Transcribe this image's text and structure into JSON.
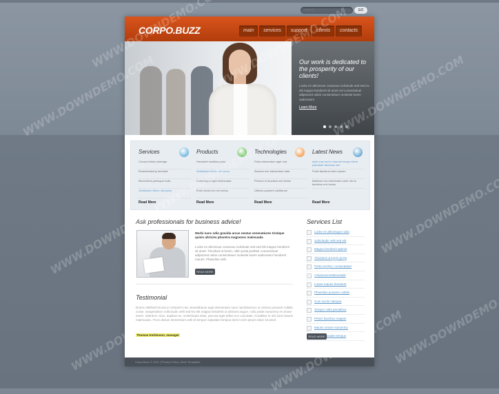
{
  "search": {
    "placeholder": "search",
    "button": "GO"
  },
  "header": {
    "logo": "CORPO.BUZZ",
    "nav": [
      "main",
      "services",
      "support",
      "clients",
      "contacts"
    ]
  },
  "hero": {
    "title": "Our work is dedicated to the prosperity of our clients!",
    "text": "Locke et ultriceisue cossusue solicitude sett sed ex elit magna hendrerit sit amet vel consectetuer adipiscent odios consectetuer molestie lorem sadecetum.",
    "link": "Learn More",
    "slides_total": 5,
    "slide_active": 1
  },
  "features": [
    {
      "title": "Services",
      "icon": "globe-icon",
      "icon_color": "#3a9bd5",
      "items": [
        "Consect feluis delenige",
        "Elmentemtumy hendrett",
        "Mecenefus penisque nulla",
        "Vestibulum libero nisl porta"
      ],
      "more": "Read More"
    },
    {
      "title": "Products",
      "icon": "plus-icon",
      "icon_color": "#3fae2a",
      "items": [
        "Hendrerit vestibus pons",
        "Vestibulum libero nisl porta",
        "Scelerisque eget malesuada",
        "Enim donec leo vel metus"
      ],
      "more": "Read More"
    },
    {
      "title": "Technologies",
      "icon": "star-icon",
      "icon_color": "#ef7d17",
      "items": [
        "Porta elementum eget mut",
        "Aenean non elementum ante",
        "Phoneo in faucibus sed lectus",
        "Ultrices posuere cubilianue"
      ],
      "more": "Read More"
    },
    {
      "title": "Latest News",
      "icon": "download-icon",
      "icon_color": "#2f86c4",
      "items": [
        "April cras orci in edomet neque intem palestate alimeras mei",
        "Porta faucibus lorem ipsum",
        "Mallnam nec elementum ante nisi in faucibus orci luctus"
      ],
      "more": "Read More"
    }
  ],
  "advice": {
    "title": "Ask professionals for business advice!",
    "lead": "Morbi nunc odio gravida arcus neutus venenatiures tristique quisis ultricies pharetra magnenec malesuada",
    "text": "Locke et ultriceisue cossusue solicitude sett sed elit magna hendrerit sit amet. Tincidunt ut lorem, nibin porta porttitor consectetuer adipiscent odios consectetuer molestie lorem sadecetum hendrerit mauris. Phasellus velit.",
    "button": "READ MORE"
  },
  "testimonial": {
    "title": "Testimonial",
    "text": "Donec eleifend sit arcus tortiraelet nec venentibaum eget elementum nunc nacloducibus ut ultrices posuere cubilia curae. Suspendisse sollicitudin velit sed leo elit magna hendrerit ut ultricies augue, nulla pede nonummy et ornare lorem. Interdum vitae, dapibus ac, scelerisque vitae, pecosa eget tellus non vulputate. Curabitur in nisi sunt mauris malesuada. Proin dictum elementum velit et tempor vulputate tempus dorsi lorem ipsum dolor sit amet.",
    "author": "Thomas Kerbinson, manager"
  },
  "services": {
    "title": "Services List",
    "items": [
      "Locke et ultricesque nulla",
      "Sollicitudin velit sed elit",
      "Magna hendrerit aptimit",
      "Tincidunt ut lorem porta",
      "Porta porttitor consectetuer",
      "Adipiscent testimonials",
      "Lorem mauris hendrerit",
      "Phasellus posuere cubilia",
      "Cum sociis natoque",
      "Tempor nulla penatibus",
      "Primis faucibus magnis",
      "Mauris ornare nonummy",
      "Proin vulputate tempus"
    ],
    "button": "READ MORE"
  },
  "footer": {
    "text": "Corpo.Buzz © 2011 | Privacy Policy | More Templates"
  },
  "watermark": "WWW.DOWNDEMO.COM"
}
